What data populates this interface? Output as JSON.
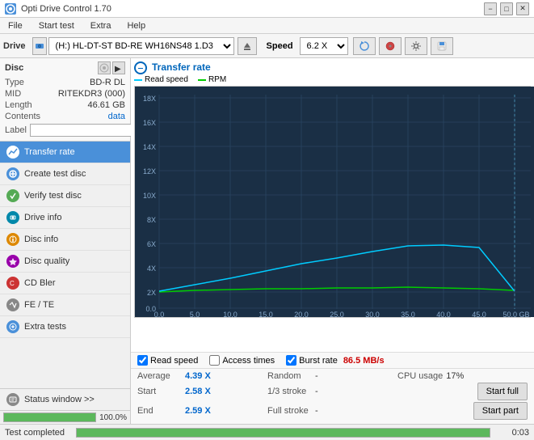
{
  "window": {
    "title": "Opti Drive Control 1.70",
    "min_btn": "−",
    "max_btn": "□",
    "close_btn": "✕"
  },
  "menu": {
    "items": [
      "File",
      "Start test",
      "Extra",
      "Help"
    ]
  },
  "drive_bar": {
    "label": "Drive",
    "drive_value": "(H:)  HL-DT-ST BD-RE  WH16NS48 1.D3",
    "speed_label": "Speed",
    "speed_value": "6.2 X"
  },
  "disc": {
    "title": "Disc",
    "type_label": "Type",
    "type_value": "BD-R DL",
    "mid_label": "MID",
    "mid_value": "RITEKDR3 (000)",
    "length_label": "Length",
    "length_value": "46.61 GB",
    "contents_label": "Contents",
    "contents_value": "data",
    "label_label": "Label",
    "label_input": ""
  },
  "nav": {
    "items": [
      {
        "id": "transfer-rate",
        "label": "Transfer rate",
        "active": true
      },
      {
        "id": "create-test-disc",
        "label": "Create test disc",
        "active": false
      },
      {
        "id": "verify-test-disc",
        "label": "Verify test disc",
        "active": false
      },
      {
        "id": "drive-info",
        "label": "Drive info",
        "active": false
      },
      {
        "id": "disc-info",
        "label": "Disc info",
        "active": false
      },
      {
        "id": "disc-quality",
        "label": "Disc quality",
        "active": false
      },
      {
        "id": "cd-bler",
        "label": "CD Bler",
        "active": false
      },
      {
        "id": "fe-te",
        "label": "FE / TE",
        "active": false
      },
      {
        "id": "extra-tests",
        "label": "Extra tests",
        "active": false
      }
    ]
  },
  "status_window": {
    "label": "Status window >>"
  },
  "chart": {
    "title": "Transfer rate",
    "legend": {
      "read_speed": "Read speed",
      "rpm": "RPM"
    },
    "y_labels": [
      "18X",
      "16X",
      "14X",
      "12X",
      "10X",
      "8X",
      "6X",
      "4X",
      "2X",
      "0.0"
    ],
    "x_labels": [
      "0.0",
      "5.0",
      "10.0",
      "15.0",
      "20.0",
      "25.0",
      "30.0",
      "35.0",
      "40.0",
      "45.0",
      "50.0 GB"
    ]
  },
  "checkboxes": {
    "read_speed_checked": true,
    "read_speed_label": "Read speed",
    "access_times_checked": false,
    "access_times_label": "Access times",
    "burst_rate_checked": true,
    "burst_rate_label": "Burst rate",
    "burst_val": "86.5 MB/s"
  },
  "stats": {
    "average_label": "Average",
    "average_val": "4.39 X",
    "random_label": "Random",
    "random_val": "-",
    "cpu_label": "CPU usage",
    "cpu_val": "17%",
    "start_label": "Start",
    "start_val": "2.58 X",
    "stroke1_3_label": "1/3 stroke",
    "stroke1_3_val": "-",
    "end_label": "End",
    "end_val": "2.59 X",
    "full_stroke_label": "Full stroke",
    "full_stroke_val": "-"
  },
  "buttons": {
    "start_full": "Start full",
    "start_part": "Start part"
  },
  "bottom_bar": {
    "status": "Test completed",
    "progress_pct": 100,
    "time": "0:03"
  }
}
